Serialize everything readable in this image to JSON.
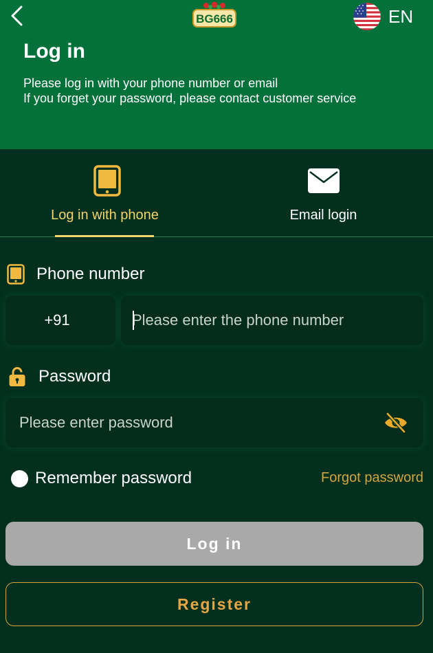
{
  "header": {
    "logo_text": "BG666",
    "language": "EN",
    "title": "Log in",
    "subtitle_lines": [
      "Please log in with your phone number or email",
      "If you forget your password, please contact customer service"
    ]
  },
  "tabs": [
    {
      "label": "Log in with phone",
      "icon": "phone-icon",
      "active": true
    },
    {
      "label": "Email login",
      "icon": "envelope-icon",
      "active": false
    }
  ],
  "form": {
    "phone": {
      "label": "Phone number",
      "country_code": "+91",
      "placeholder": "Please enter the phone number",
      "value": ""
    },
    "password": {
      "label": "Password",
      "placeholder": "Please enter password",
      "value": ""
    },
    "remember_label": "Remember password",
    "remember_checked": false,
    "forgot_label": "Forgot password"
  },
  "buttons": {
    "login": "Log in",
    "register": "Register"
  },
  "colors": {
    "header_bg": "#04703a",
    "body_bg": "#03301e",
    "accent_gold": "#f3d36a",
    "link_gold": "#d3a43f",
    "disabled_button": "#a9a9a9"
  }
}
